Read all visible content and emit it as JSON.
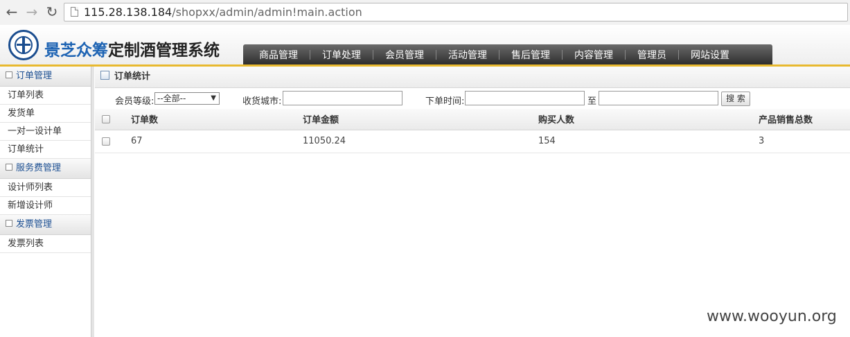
{
  "browser": {
    "back_icon": "back-arrow-icon",
    "forward_icon": "forward-arrow-icon",
    "reload_icon": "reload-icon",
    "url_host": "115.28.138.184",
    "url_path": "/shopxx/admin/admin!main.action"
  },
  "header": {
    "brand_part1": "景芝众筹",
    "brand_part2": "定制酒管理系统",
    "nav": [
      "商品管理",
      "订单处理",
      "会员管理",
      "活动管理",
      "售后管理",
      "内容管理",
      "管理员",
      "网站设置"
    ]
  },
  "sidebar": {
    "groups": [
      {
        "title": "订单管理",
        "items": [
          "订单列表",
          "发货单",
          "一对一设计单",
          "订单统计"
        ]
      },
      {
        "title": "服务费管理",
        "items": [
          "设计师列表",
          "新增设计师"
        ]
      },
      {
        "title": "发票管理",
        "items": [
          "发票列表"
        ]
      }
    ]
  },
  "main": {
    "title": "订单统计",
    "filters": {
      "member_level_label": "会员等级:",
      "member_level_value": "--全部--",
      "city_label": "收货城市:",
      "time_label": "下单时间:",
      "to_label": "至",
      "search_button": "搜 索"
    },
    "table": {
      "headers": [
        "订单数",
        "订单金额",
        "购买人数",
        "产品销售总数"
      ],
      "rows": [
        [
          "67",
          "11050.24",
          "154",
          "3"
        ]
      ]
    }
  },
  "watermark": "www.wooyun.org",
  "colors": {
    "accent": "#e8b92f",
    "brand_blue": "#1d63b3",
    "nav_bg": "#3a3a3a"
  }
}
